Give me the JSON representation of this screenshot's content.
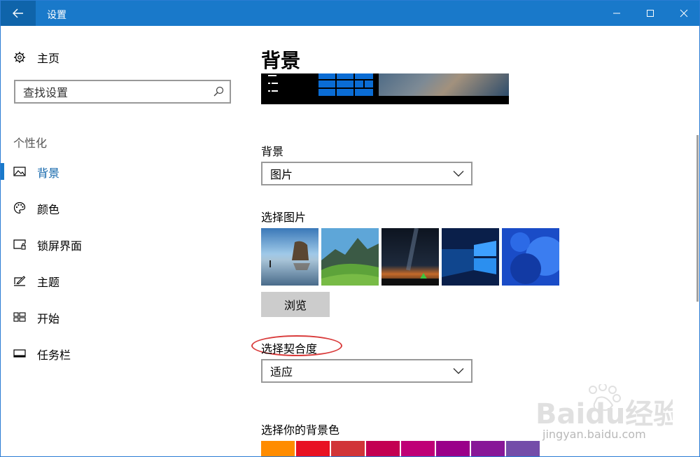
{
  "window": {
    "title": "设置"
  },
  "sidebar": {
    "home_label": "主页",
    "search_placeholder": "查找设置",
    "section_label": "个性化",
    "items": [
      {
        "label": "背景",
        "icon": "picture-icon",
        "active": true
      },
      {
        "label": "颜色",
        "icon": "palette-icon",
        "active": false
      },
      {
        "label": "锁屏界面",
        "icon": "lock-screen-icon",
        "active": false
      },
      {
        "label": "主题",
        "icon": "theme-brush-icon",
        "active": false
      },
      {
        "label": "开始",
        "icon": "start-tiles-icon",
        "active": false
      },
      {
        "label": "任务栏",
        "icon": "taskbar-icon",
        "active": false
      }
    ]
  },
  "main": {
    "title": "背景",
    "background_label": "背景",
    "background_value": "图片",
    "choose_picture_label": "选择图片",
    "browse_label": "浏览",
    "fit_label": "选择契合度",
    "fit_value": "适应",
    "bg_color_label": "选择你的背景色",
    "thumbnails": [
      "beach-rock-thumbnail",
      "green-mountain-thumbnail",
      "night-sky-tent-thumbnail",
      "windows-logo-thumbnail",
      "blue-abstract-thumbnail"
    ],
    "swatch_colors": [
      "#ff8c00",
      "#e81123",
      "#d13438",
      "#c30052",
      "#bf0077",
      "#9a0089",
      "#881798",
      "#744da9"
    ]
  },
  "colors": {
    "accent": "#1979ca",
    "titlebar": "#1979ca",
    "annotation": "#d93b3b"
  },
  "watermark": {
    "brand": "Baidu经验",
    "url": "jingyan.baidu.com"
  }
}
